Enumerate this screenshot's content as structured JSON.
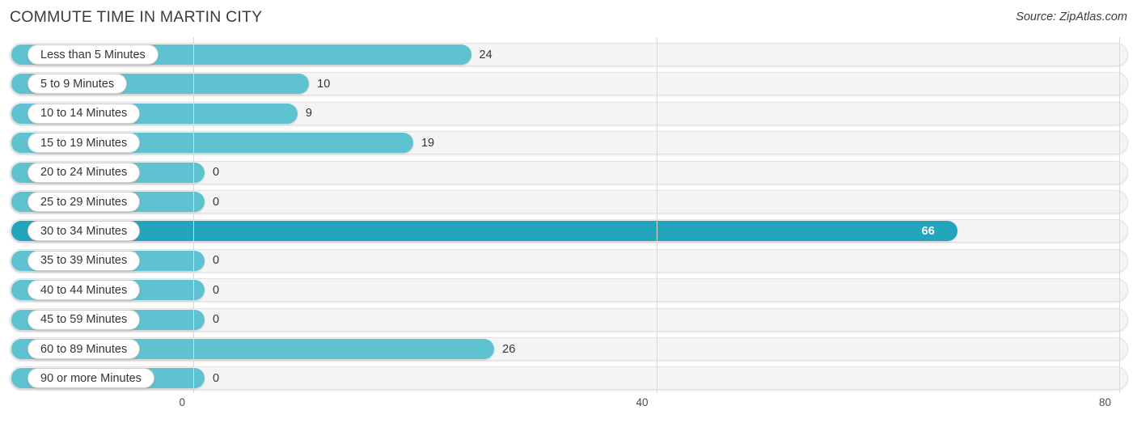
{
  "header": {
    "title": "COMMUTE TIME IN MARTIN CITY",
    "source": "Source: ZipAtlas.com"
  },
  "colors": {
    "bar": "#5fc2d0",
    "bar_max": "#23a6bd",
    "track": "#f4f4f4",
    "gridline": "#d9d9d9",
    "text": "#33333a"
  },
  "axis": {
    "ticks": [
      "0",
      "40",
      "80"
    ],
    "min": 0,
    "max": 80
  },
  "chart_data": {
    "type": "bar",
    "orientation": "horizontal",
    "title": "COMMUTE TIME IN MARTIN CITY",
    "source": "Source: ZipAtlas.com",
    "xlabel": "",
    "ylabel": "",
    "xlim": [
      0,
      80
    ],
    "xticks": [
      0,
      40,
      80
    ],
    "grid": true,
    "legend": false,
    "max_value": 66,
    "categories": [
      "Less than 5 Minutes",
      "5 to 9 Minutes",
      "10 to 14 Minutes",
      "15 to 19 Minutes",
      "20 to 24 Minutes",
      "25 to 29 Minutes",
      "30 to 34 Minutes",
      "35 to 39 Minutes",
      "40 to 44 Minutes",
      "45 to 59 Minutes",
      "60 to 89 Minutes",
      "90 or more Minutes"
    ],
    "values": [
      24,
      10,
      9,
      19,
      0,
      0,
      66,
      0,
      0,
      0,
      26,
      0
    ],
    "labels": [
      "24",
      "10",
      "9",
      "19",
      "0",
      "0",
      "66",
      "0",
      "0",
      "0",
      "26",
      "0"
    ]
  }
}
